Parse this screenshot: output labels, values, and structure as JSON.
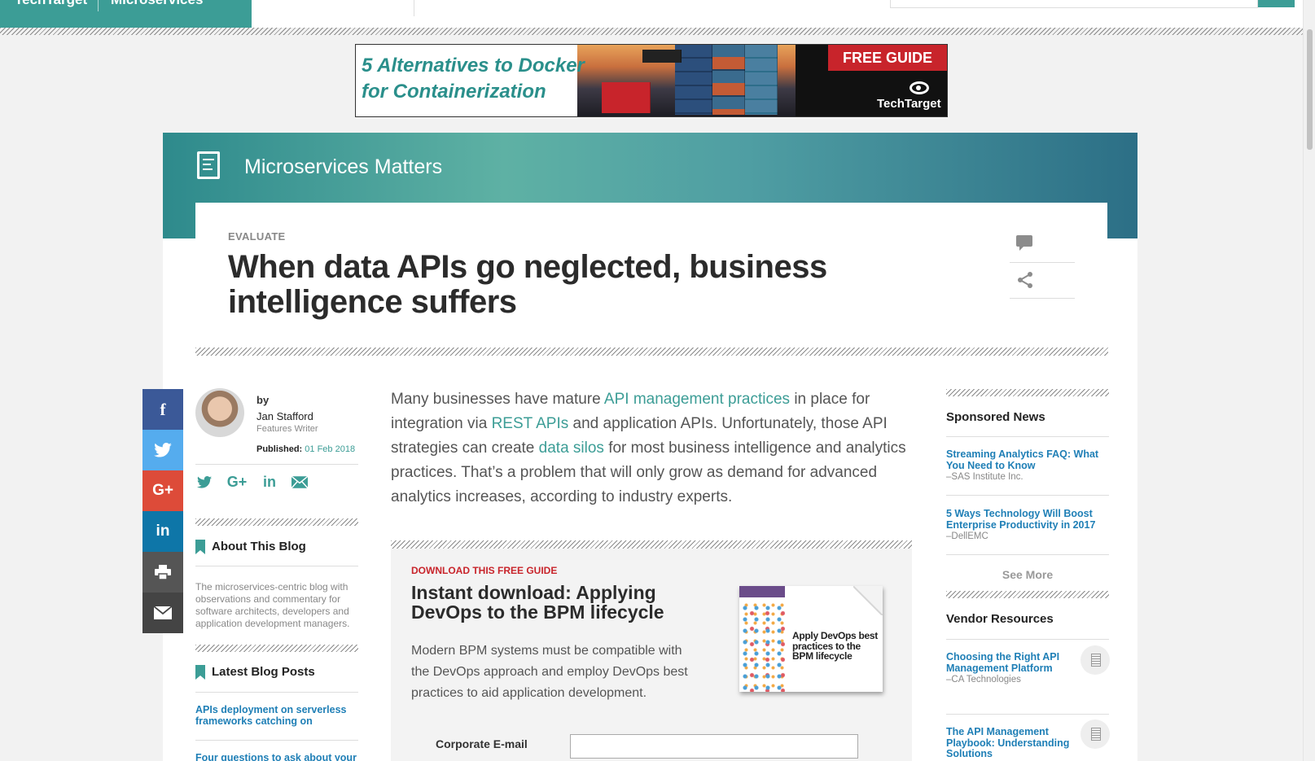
{
  "topbar": {
    "brand": "TechTarget",
    "section": "Microservices"
  },
  "ad": {
    "headline": "5 Alternatives to Docker for Containerization",
    "cta": "FREE GUIDE",
    "brand": "TechTarget"
  },
  "blog": {
    "title": "Microservices Matters"
  },
  "article": {
    "kicker": "EVALUATE",
    "title": "When data APIs go neglected, business intelligence suffers"
  },
  "author": {
    "by": "by",
    "name": "Jan Stafford",
    "role": "Features Writer",
    "published_label": "Published:",
    "published_date": "01 Feb 2018"
  },
  "about": {
    "title": "About This Blog",
    "text": "The microservices-centric blog with observations and commentary for software architects, developers and application development managers."
  },
  "latest": {
    "title": "Latest Blog Posts",
    "posts": [
      "APIs deployment on serverless frameworks catching on",
      "Four questions to ask about your"
    ]
  },
  "lede": {
    "p1": "Many businesses have mature ",
    "link1": "API management practices",
    "p2": " in place for integration via ",
    "link2": "REST APIs",
    "p3": " and application APIs. Unfortunately, those API strategies can create ",
    "link3": "data silos",
    "p4": " for most business intelligence and analytics practices. That’s a problem that will only grow as demand for advanced analytics increases, according to industry experts."
  },
  "guide": {
    "kicker": "DOWNLOAD THIS FREE GUIDE",
    "title": "Instant download: Applying DevOps to the BPM lifecycle",
    "description": "Modern BPM systems must be compatible with the DevOps approach and employ DevOps best practices to aid application development.",
    "cover_title": "Apply DevOps best practices to the BPM lifecycle",
    "email_label": "Corporate E-mail"
  },
  "rail": {
    "sponsored_title": "Sponsored News",
    "sponsored": [
      {
        "title": "Streaming Analytics FAQ: What You Need to Know",
        "source": "–SAS Institute Inc."
      },
      {
        "title": "5 Ways Technology Will Boost Enterprise Productivity in 2017",
        "source": "–DellEMC"
      }
    ],
    "see_more": "See More",
    "vendor_title": "Vendor Resources",
    "vendor": [
      {
        "title": "Choosing the Right API Management Platform",
        "source": "–CA Technologies"
      },
      {
        "title": "The API Management Playbook: Understanding Solutions",
        "source": ""
      }
    ]
  },
  "share_icons": [
    "facebook-icon",
    "twitter-icon",
    "google-plus-icon",
    "linkedin-icon",
    "print-icon",
    "email-icon"
  ],
  "colors": {
    "teal": "#3c9d96",
    "link_blue": "#1f7fb6",
    "ad_red": "#c8242b"
  }
}
